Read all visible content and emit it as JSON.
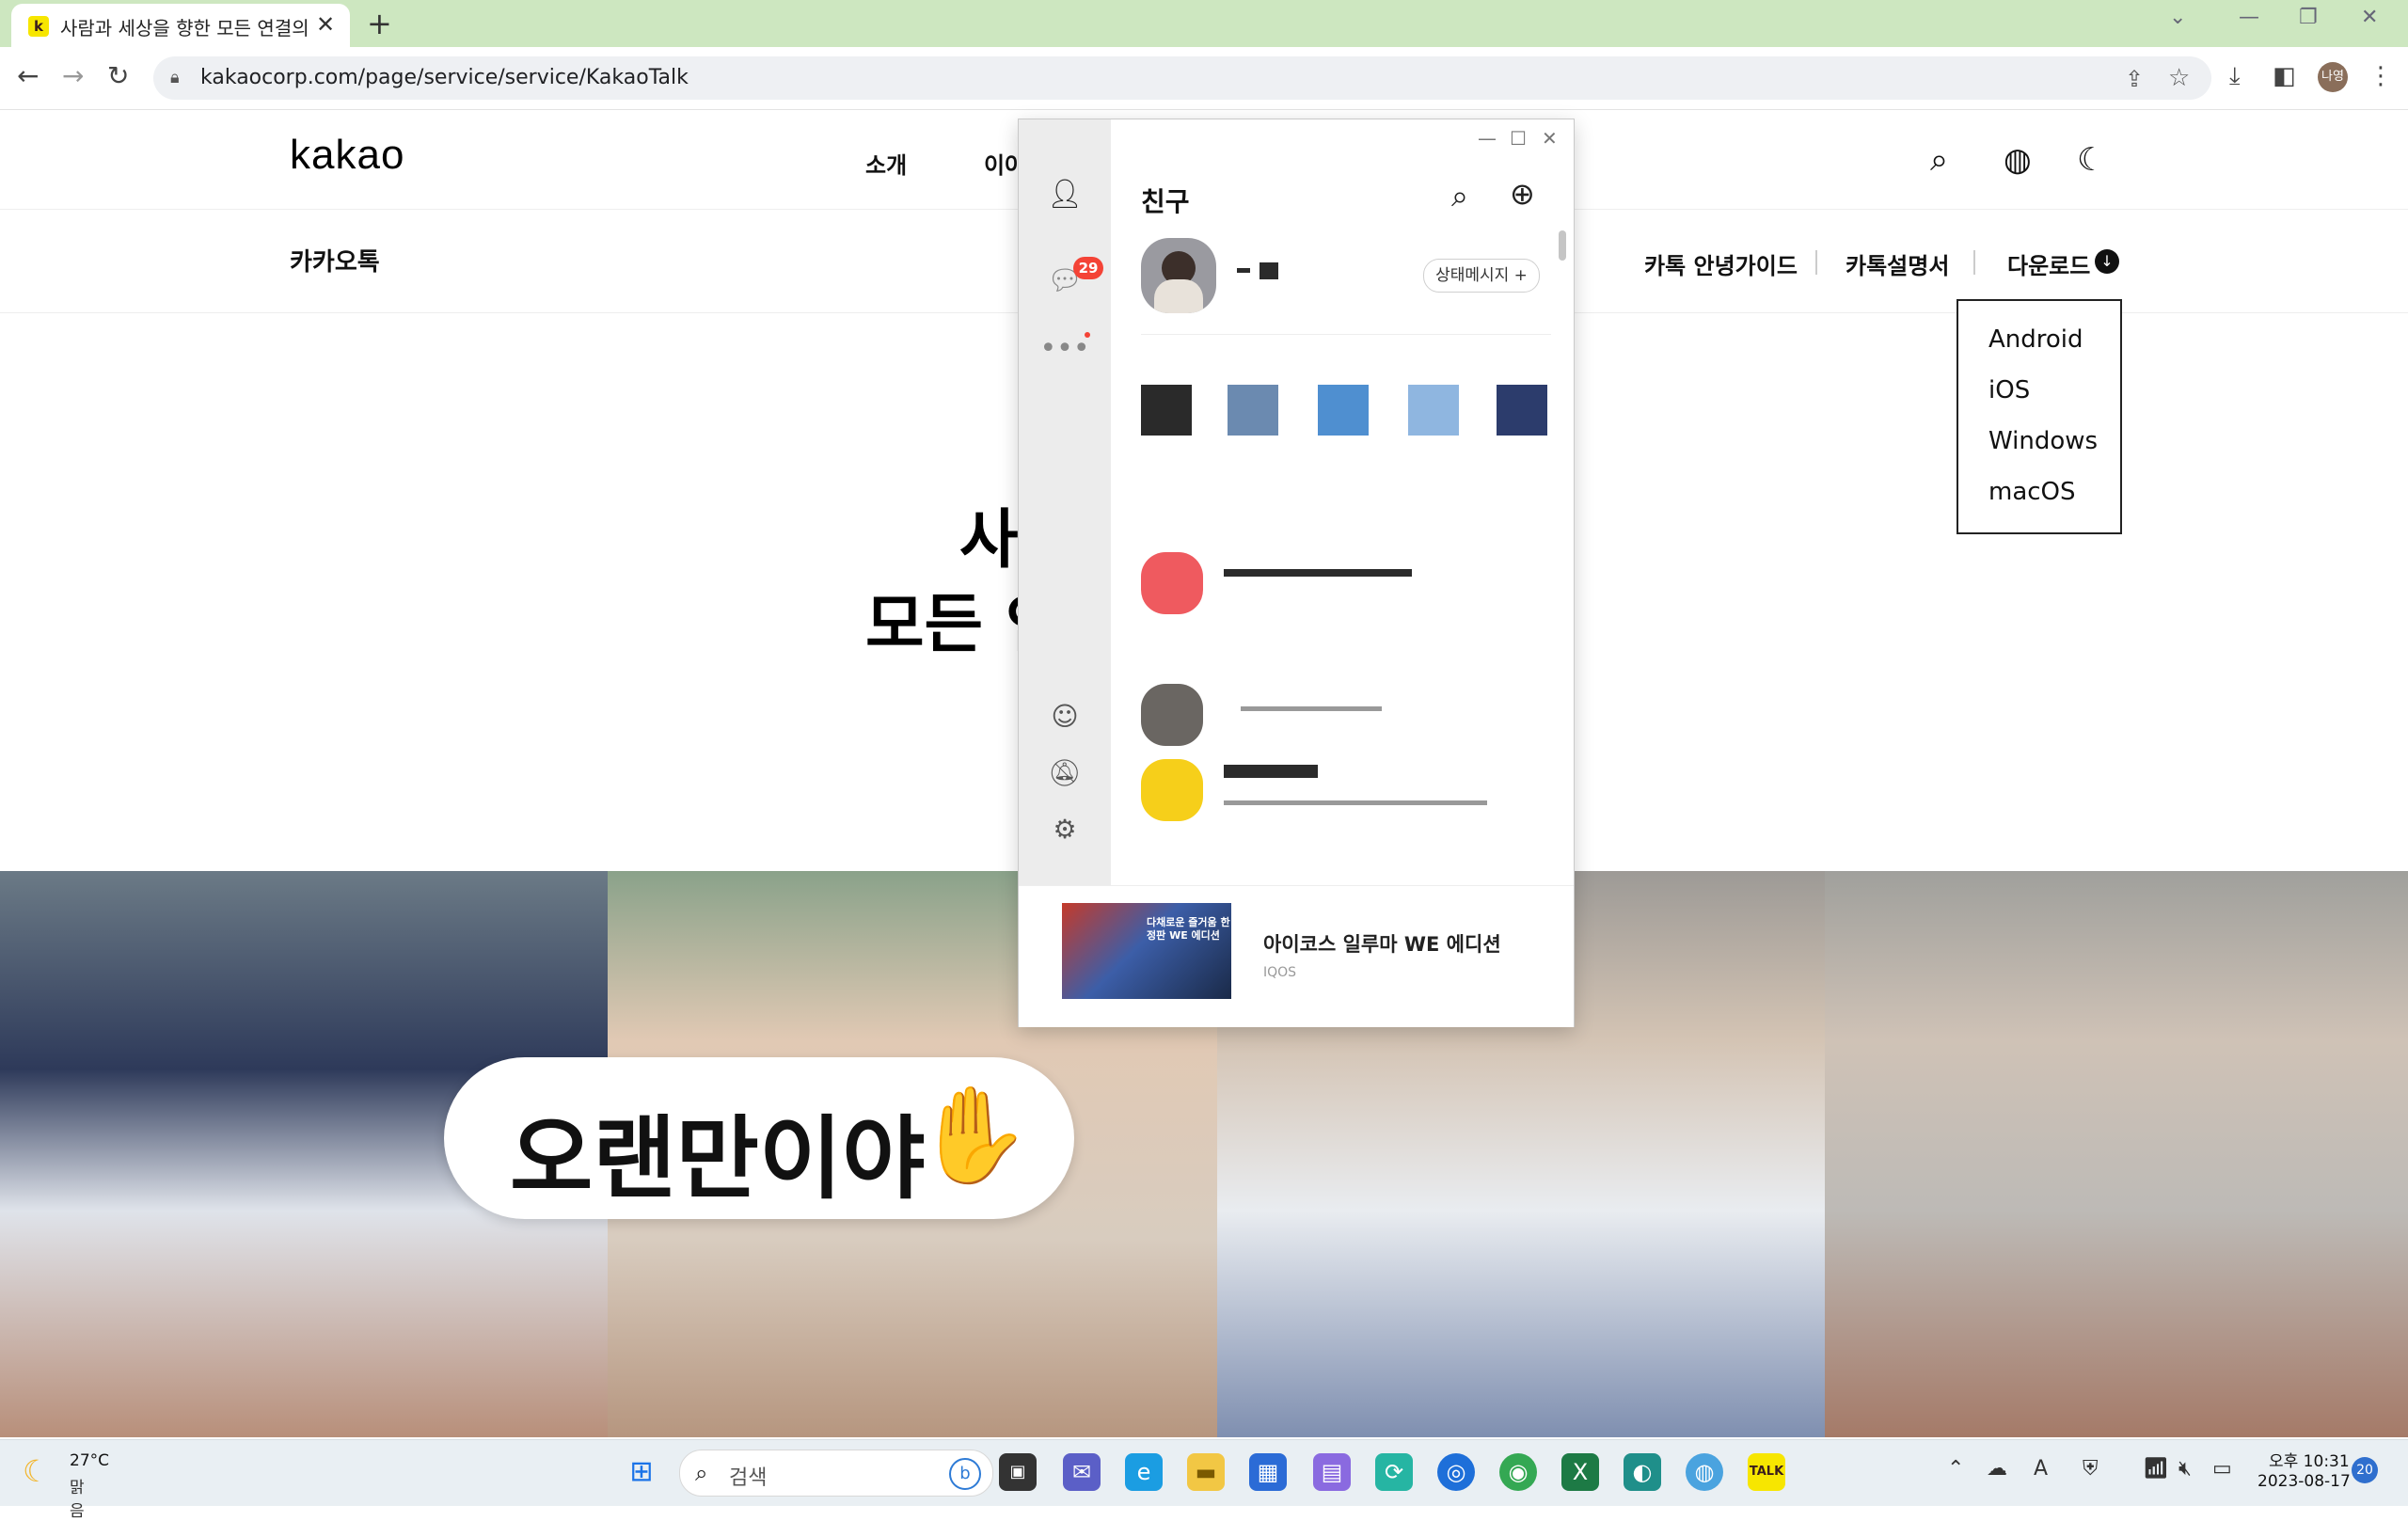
{
  "browser": {
    "tab_title": "사람과 세상을 향한 모든 연결의",
    "tab_favicon": "k",
    "url": "kakaocorp.com/page/service/service/KakaoTalk",
    "profile_label": "나영"
  },
  "site": {
    "logo": "kakao",
    "gnb": [
      "소개",
      "이야"
    ],
    "subtitle": "카카오톡",
    "sub_links": [
      "카톡 안녕가이드",
      "카톡설명서",
      "다운로드"
    ],
    "download_menu": [
      "Android",
      "iOS",
      "Windows",
      "macOS"
    ],
    "hero_line1": "사",
    "hero_line2": "모든 인",
    "bubble_text": "오랜만이야",
    "bubble_icon": "waving-hand-icon"
  },
  "kakaotalk": {
    "title": "친구",
    "chat_badge": "29",
    "status_button": "상태메시지 +",
    "ad_title": "아이코스 일루마 WE 에디션",
    "ad_sub": "IQOS",
    "ad_image_text": "다채로운 즐거움 한정판 WE 에디션"
  },
  "taskbar": {
    "weather_temp": "27°C",
    "weather_cond": "맑음",
    "search_placeholder": "검색",
    "time": "오후 10:31",
    "date": "2023-08-17",
    "notifications": "20"
  },
  "colors": {
    "kakao_yellow": "#f7e600",
    "badge_red": "#f44336",
    "tab_strip_green": "#cde7c0"
  }
}
